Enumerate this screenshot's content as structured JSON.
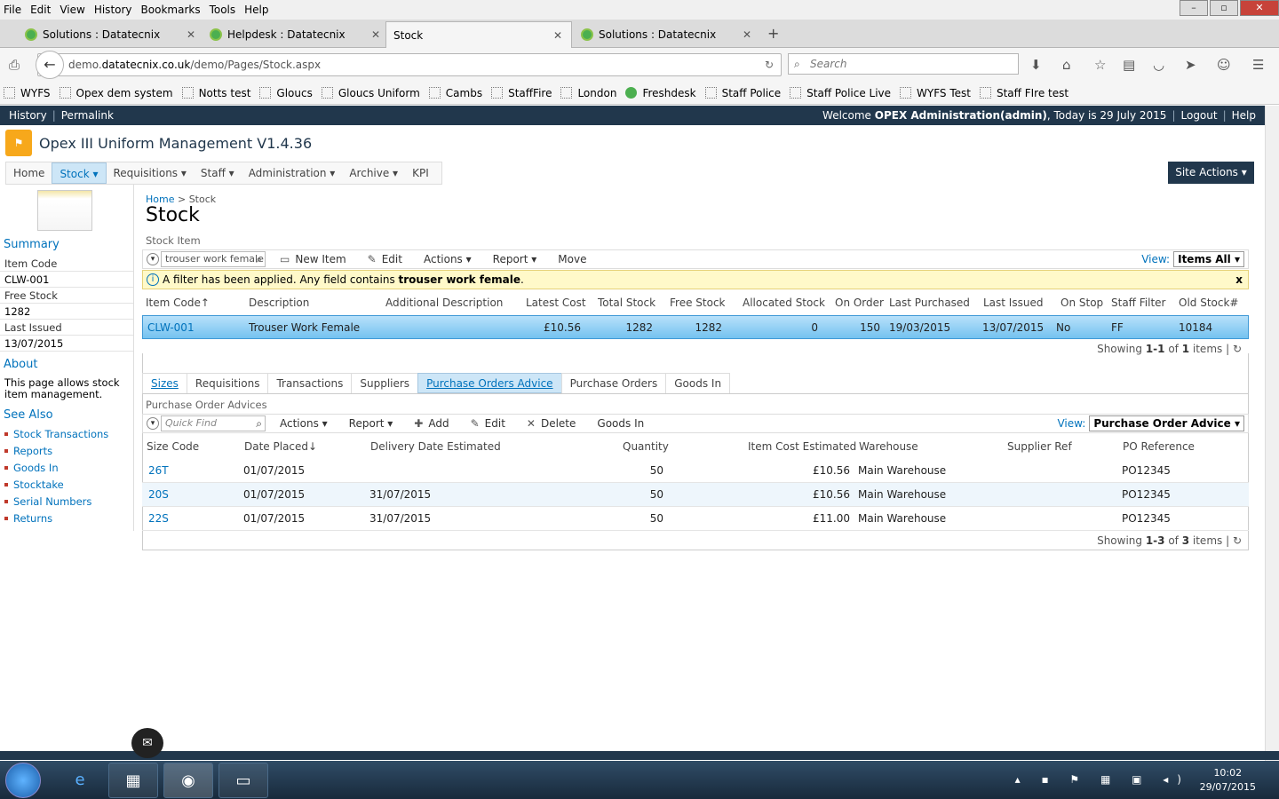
{
  "browser": {
    "menu": [
      "File",
      "Edit",
      "View",
      "History",
      "Bookmarks",
      "Tools",
      "Help"
    ],
    "tabs": [
      {
        "label": "Solutions : Datatecnix"
      },
      {
        "label": "Helpdesk : Datatecnix"
      },
      {
        "label": "Stock"
      },
      {
        "label": "Solutions : Datatecnix"
      }
    ],
    "url_pre": "demo.",
    "url_host": "datatecnix.co.uk",
    "url_path": "/demo/Pages/Stock.aspx",
    "search_placeholder": "Search",
    "bookmarks": [
      "WYFS",
      "Opex dem system",
      "Notts test",
      "Gloucs",
      "Gloucs Uniform",
      "Cambs",
      "StaffFire",
      "London",
      "Freshdesk",
      "Staff Police",
      "Staff Police Live",
      "WYFS Test",
      "Staff FIre test"
    ]
  },
  "sp": {
    "history": "History",
    "permalink": "Permalink",
    "welcome_pre": "Welcome ",
    "user": "OPEX Administration(admin)",
    "welcome_post": ", Today is 29 July 2015",
    "logout": "Logout",
    "help": "Help",
    "site_title": "Opex III Uniform Management V1.4.36",
    "nav": [
      "Home",
      "Stock ▾",
      "Requisitions ▾",
      "Staff ▾",
      "Administration ▾",
      "Archive ▾",
      "KPI"
    ],
    "site_actions": "Site Actions ▾"
  },
  "left": {
    "summary": "Summary",
    "item_code_label": "Item Code",
    "item_code": "CLW-001",
    "free_stock_label": "Free Stock",
    "free_stock": "1282",
    "last_issued_label": "Last Issued",
    "last_issued": "13/07/2015",
    "about": "About",
    "about_text": "This page allows stock item management.",
    "see_also": "See Also",
    "links": [
      "Stock Transactions",
      "Reports",
      "Goods In",
      "Stocktake",
      "Serial Numbers",
      "Returns"
    ]
  },
  "main": {
    "crumb_home": "Home",
    "crumb_sep": ">",
    "crumb_current": "Stock",
    "title": "Stock",
    "webpart1": "Stock Item",
    "search_value": "trouser work female",
    "tb1": {
      "new": "New Item",
      "edit": "Edit",
      "actions": "Actions ▾",
      "report": "Report ▾",
      "move": "Move"
    },
    "view_label": "View:",
    "view1": "Items All ▾",
    "filter_pre": "A filter has been applied. Any field contains ",
    "filter_term": "trouser work female",
    "filter_post": ".",
    "filter_close": "x",
    "cols1": [
      "Item Code↑",
      "Description",
      "Additional Description",
      "Latest Cost",
      "Total Stock",
      "Free Stock",
      "Allocated Stock",
      "On Order",
      "Last Purchased",
      "Last Issued",
      "On Stop",
      "Staff Filter",
      "Old Stock#"
    ],
    "row1": [
      "CLW-001",
      "Trouser Work Female",
      "",
      "£10.56",
      "1282",
      "1282",
      "0",
      "150",
      "19/03/2015",
      "13/07/2015",
      "No",
      "FF",
      "10184"
    ],
    "showing1": {
      "pre": "Showing ",
      "range": "1-1",
      "mid": " of ",
      "total": "1",
      "post": " items"
    },
    "tabs": [
      "Sizes",
      "Requisitions",
      "Transactions",
      "Suppliers",
      "Purchase Orders Advice",
      "Purchase Orders",
      "Goods In"
    ],
    "webpart2": "Purchase Order Advices",
    "quick_find": "Quick Find",
    "tb2": {
      "actions": "Actions ▾",
      "report": "Report ▾",
      "add": "Add",
      "edit": "Edit",
      "delete": "Delete",
      "goods_in": "Goods In"
    },
    "view2": "Purchase Order Advice ▾",
    "cols2": [
      "Size Code",
      "Date Placed↓",
      "Delivery Date Estimated",
      "Quantity",
      "Item Cost Estimated",
      "Warehouse",
      "Supplier Ref",
      "PO Reference"
    ],
    "rows2": [
      [
        "26T",
        "01/07/2015",
        "",
        "50",
        "£10.56",
        "Main Warehouse",
        "",
        "PO12345"
      ],
      [
        "20S",
        "01/07/2015",
        "31/07/2015",
        "50",
        "£10.56",
        "Main Warehouse",
        "",
        "PO12345"
      ],
      [
        "22S",
        "01/07/2015",
        "31/07/2015",
        "50",
        "£11.00",
        "Main Warehouse",
        "",
        "PO12345"
      ]
    ],
    "showing2": {
      "pre": "Showing ",
      "range": "1-3",
      "mid": " of ",
      "total": "3",
      "post": " items"
    }
  },
  "taskbar": {
    "time": "10:02",
    "date": "29/07/2015"
  }
}
